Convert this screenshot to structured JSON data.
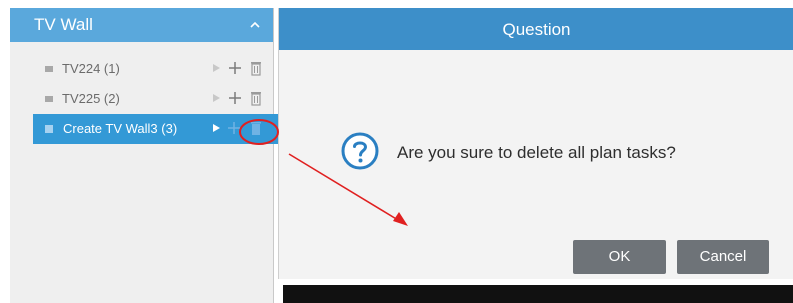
{
  "panel": {
    "title": "TV Wall",
    "items": [
      {
        "label": "TV224 (1)",
        "selected": false
      },
      {
        "label": "TV225 (2)",
        "selected": false
      },
      {
        "label": "Create TV Wall3 (3)",
        "selected": true
      }
    ]
  },
  "dialog": {
    "title": "Question",
    "message": "Are you sure to delete all plan tasks?",
    "ok_label": "OK",
    "cancel_label": "Cancel"
  },
  "icons": {
    "collapse": "chevron-up-icon",
    "play": "play-icon",
    "add": "plus-icon",
    "delete": "trash-icon",
    "question": "question-circle-icon"
  },
  "colors": {
    "panel_header": "#5aa8dc",
    "selected_row": "#3399d6",
    "dialog_title_bar": "#3d8fc9",
    "question_icon": "#2a7fc2",
    "button": "#6e7378",
    "annotation": "#e02020"
  }
}
